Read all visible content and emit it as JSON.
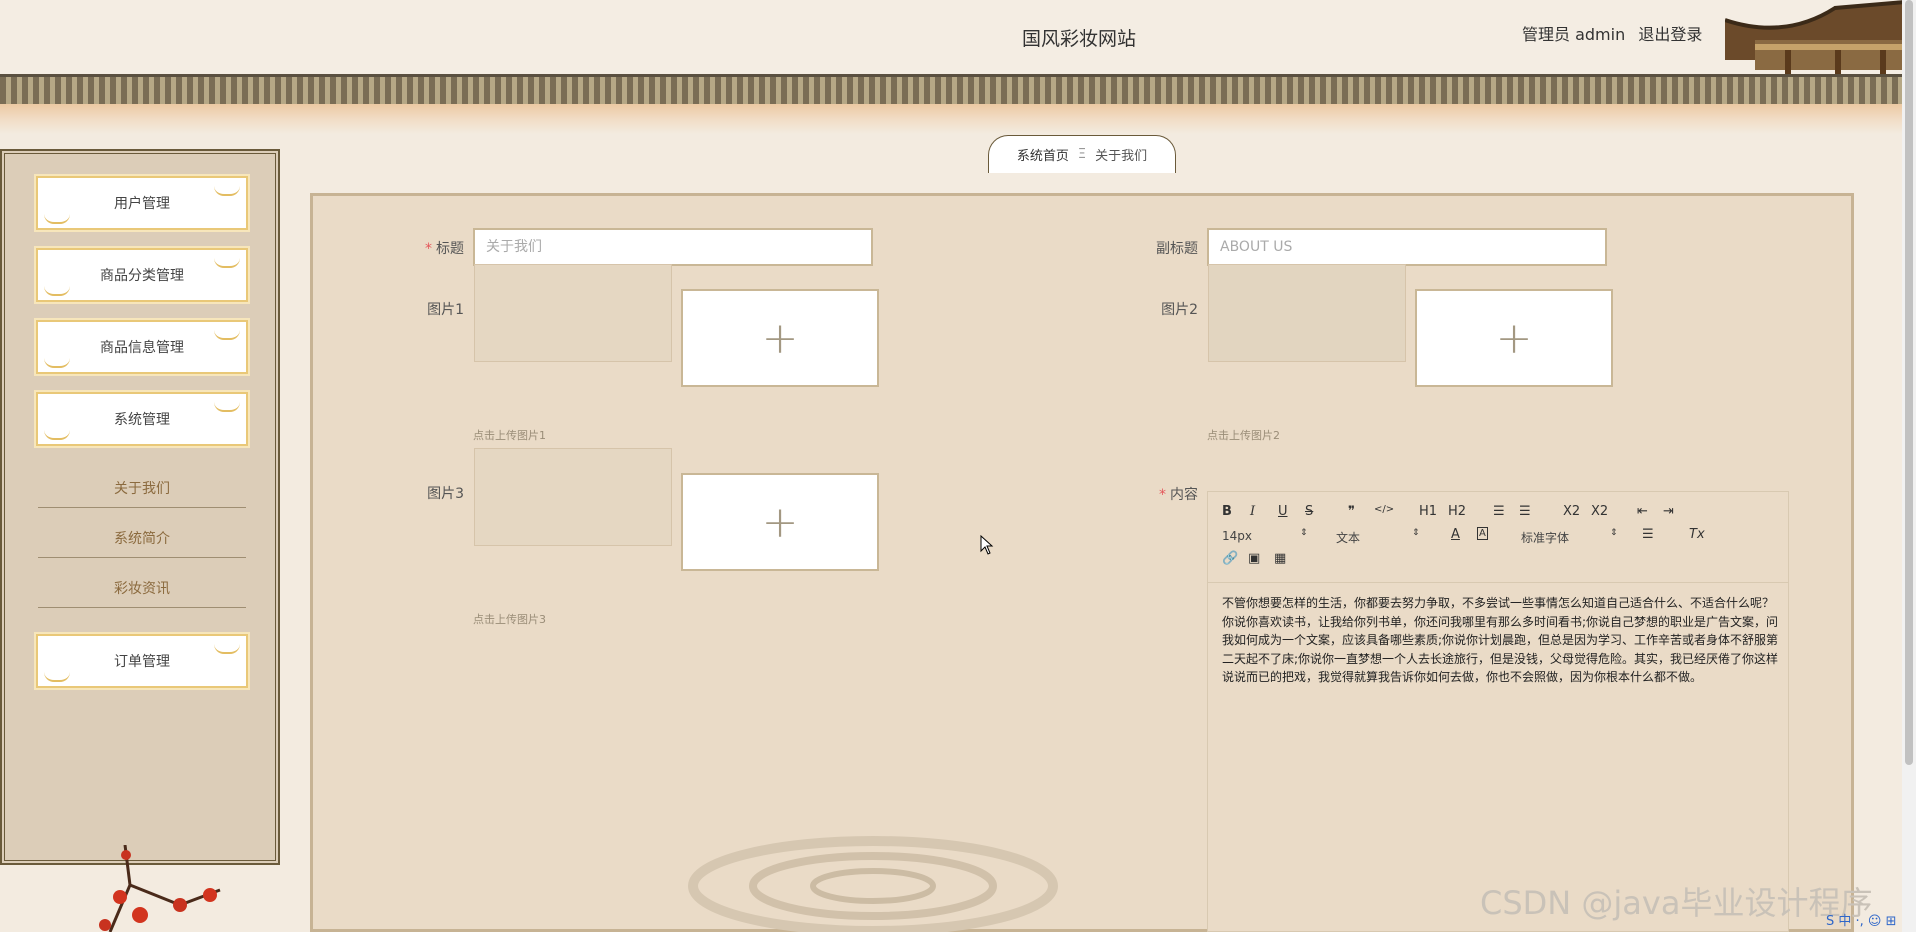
{
  "header": {
    "site_title": "国风彩妆网站",
    "role_label": "管理员 admin",
    "logout_label": "退出登录"
  },
  "sidebar": {
    "menu": [
      {
        "label": "用户管理"
      },
      {
        "label": "商品分类管理"
      },
      {
        "label": "商品信息管理"
      },
      {
        "label": "系统管理"
      }
    ],
    "sub_items": [
      {
        "label": "关于我们"
      },
      {
        "label": "系统简介"
      },
      {
        "label": "彩妆资讯"
      }
    ],
    "order_menu": {
      "label": "订单管理"
    }
  },
  "breadcrumb": {
    "home": "系统首页",
    "separator": "Ξ",
    "current": "关于我们"
  },
  "form": {
    "title": {
      "label": "标题",
      "value": "关于我们",
      "required": true
    },
    "subtitle": {
      "label": "副标题",
      "value": "ABOUT US"
    },
    "pic1": {
      "label": "图片1",
      "hint": "点击上传图片1"
    },
    "pic2": {
      "label": "图片2",
      "hint": "点击上传图片2"
    },
    "pic3": {
      "label": "图片3",
      "hint": "点击上传图片3"
    },
    "upload_glyph": "+",
    "content": {
      "label": "内容",
      "required": true,
      "text": "不管你想要怎样的生活，你都要去努力争取，不多尝试一些事情怎么知道自己适合什么、不适合什么呢？你说你喜欢读书，让我给你列书单，你还问我哪里有那么多时间看书;你说自己梦想的职业是广告文案，问我如何成为一个文案，应该具备哪些素质;你说你计划晨跑，但总是因为学习、工作辛苦或者身体不舒服第二天起不了床;你说你一直梦想一个人去长途旅行，但是没钱，父母觉得危险。其实，我已经厌倦了你这样说说而已的把戏，我觉得就算我告诉你如何去做，你也不会照做，因为你根本什么都不做。"
    }
  },
  "editor_toolbar": {
    "bold": "B",
    "italic": "I",
    "underline": "U",
    "strike": "S",
    "quote": "❞",
    "code": "</>",
    "h1": "H1",
    "h2": "H2",
    "ordered_list": "☰",
    "bullet_list": "☰",
    "subscript": "X2",
    "superscript": "X2",
    "indent_out": "⇤",
    "indent_in": "⇥",
    "size": "14px",
    "block": "文本",
    "color": "A",
    "background": "A",
    "font": "标准字体",
    "align": "☰",
    "clear": "Tx",
    "link": "🔗",
    "image": "▣",
    "video": "▦"
  },
  "watermark": "CSDN @java毕业设计程序",
  "tray": "S 中 ·, ☺ ⊞",
  "colors": {
    "page_bg": "#f3ebe0",
    "panel_bg": "#eadbc7",
    "accent_gold": "#e9c878",
    "required": "#e4565a"
  }
}
